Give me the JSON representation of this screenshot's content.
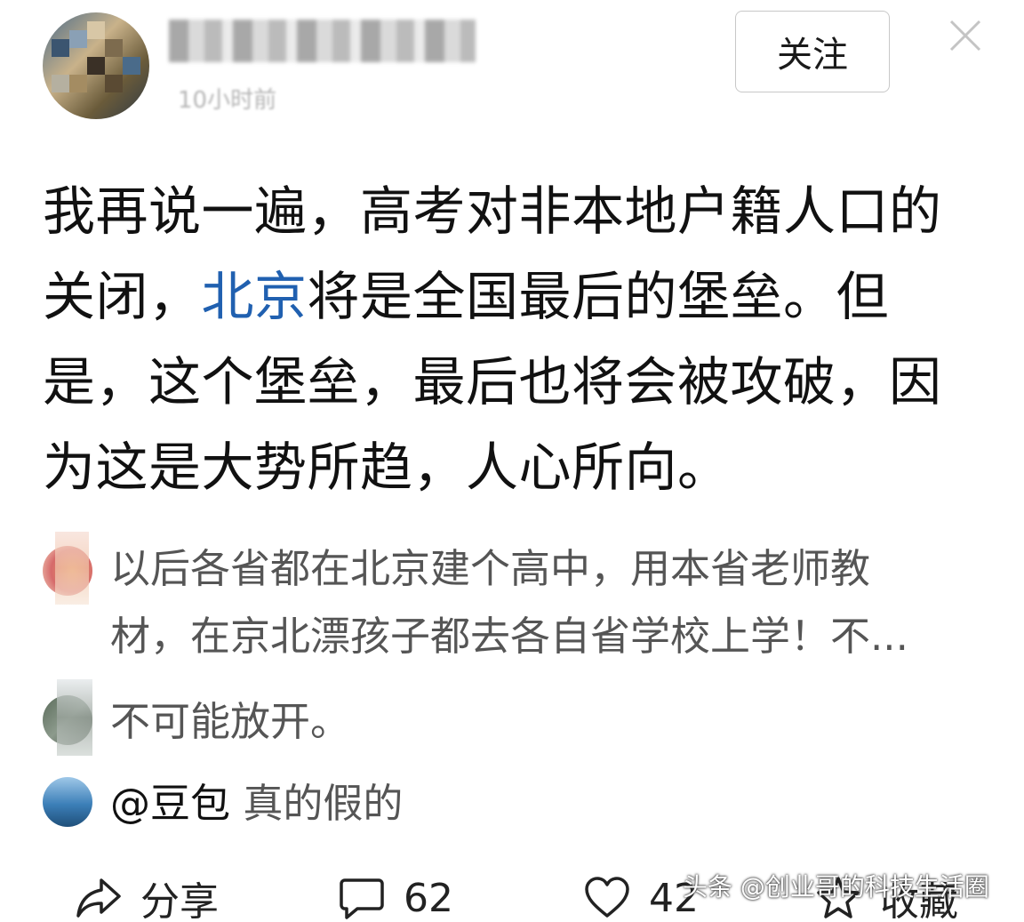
{
  "header": {
    "follow_label": "关注",
    "time_label": "10小时前"
  },
  "post": {
    "line1": "我再说一遍，高考对非本地户籍人口的",
    "line2_pre": "关闭，",
    "line2_link": "北京",
    "line2_post": "将是全国最后的堡垒。但",
    "line3": "是，这个堡垒，最后也将会被攻破，因",
    "line4": "为这是大势所趋，人心所向。"
  },
  "comments": [
    {
      "line1": "以后各省都在北京建个高中，用本省老师教",
      "line2": "材，在京北漂孩子都去各自省学校上学！不..."
    },
    {
      "text": "不可能放开。"
    },
    {
      "mention": "@豆包",
      "text": " 真的假的"
    }
  ],
  "actions": {
    "share_label": "分享",
    "comment_count": "62",
    "like_count": "42",
    "favorite_label": "收藏"
  },
  "watermark": "头条 @创业哥的科技生活圈",
  "icons": [
    "close-icon",
    "share-icon",
    "comment-icon",
    "heart-icon",
    "star-icon"
  ],
  "colors": {
    "link": "#2060b0",
    "comment_text": "#555555",
    "main_text": "#111111"
  }
}
